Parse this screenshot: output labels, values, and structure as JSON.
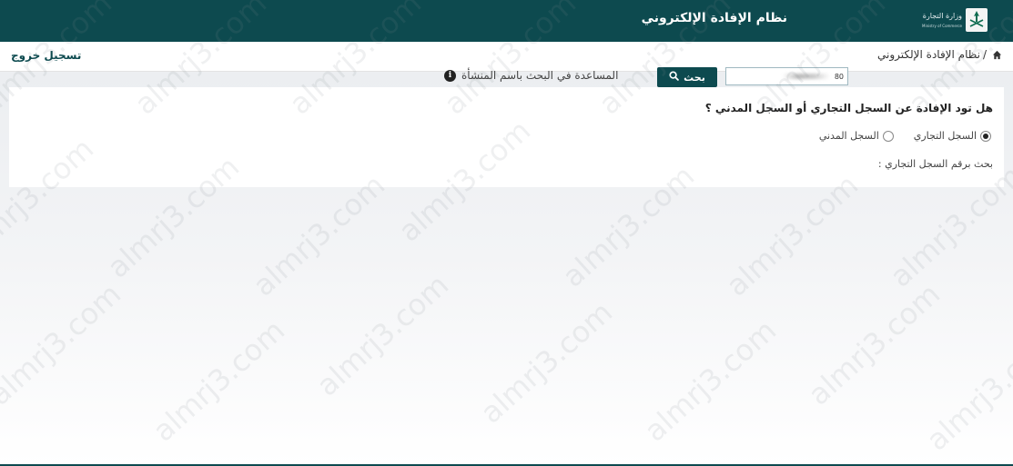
{
  "header": {
    "title": "نظام الإفادة الإلكتروني",
    "logo_text_ar": "وزارة التجارة",
    "logo_text_en": "Ministry of Commerce"
  },
  "breadcrumb": {
    "separator": "/",
    "current": "نظام الإفادة الإلكتروني"
  },
  "nav": {
    "logout_label": "تسجيل خروج"
  },
  "form": {
    "question": "هل تود الإفادة عن السجل التجاري أو السجل المدني ؟",
    "radio_options": [
      {
        "label": "السجل التجاري",
        "checked": true
      },
      {
        "label": "السجل المدني",
        "checked": false
      }
    ],
    "search_label": "بحث برقم السجل التجاري :",
    "search_value": "80",
    "search_button_label": "بحث",
    "help_text": "المساعدة في البحث باسم المنشأة"
  },
  "watermark": {
    "text": "almrj3.com"
  },
  "colors": {
    "primary": "#0d4a4f",
    "page_background": "#eef0f2",
    "panel_background": "#ffffff"
  },
  "icons": {
    "home": "home-icon",
    "search": "search-icon",
    "info": "info-icon",
    "emblem": "ministry-emblem-icon"
  }
}
